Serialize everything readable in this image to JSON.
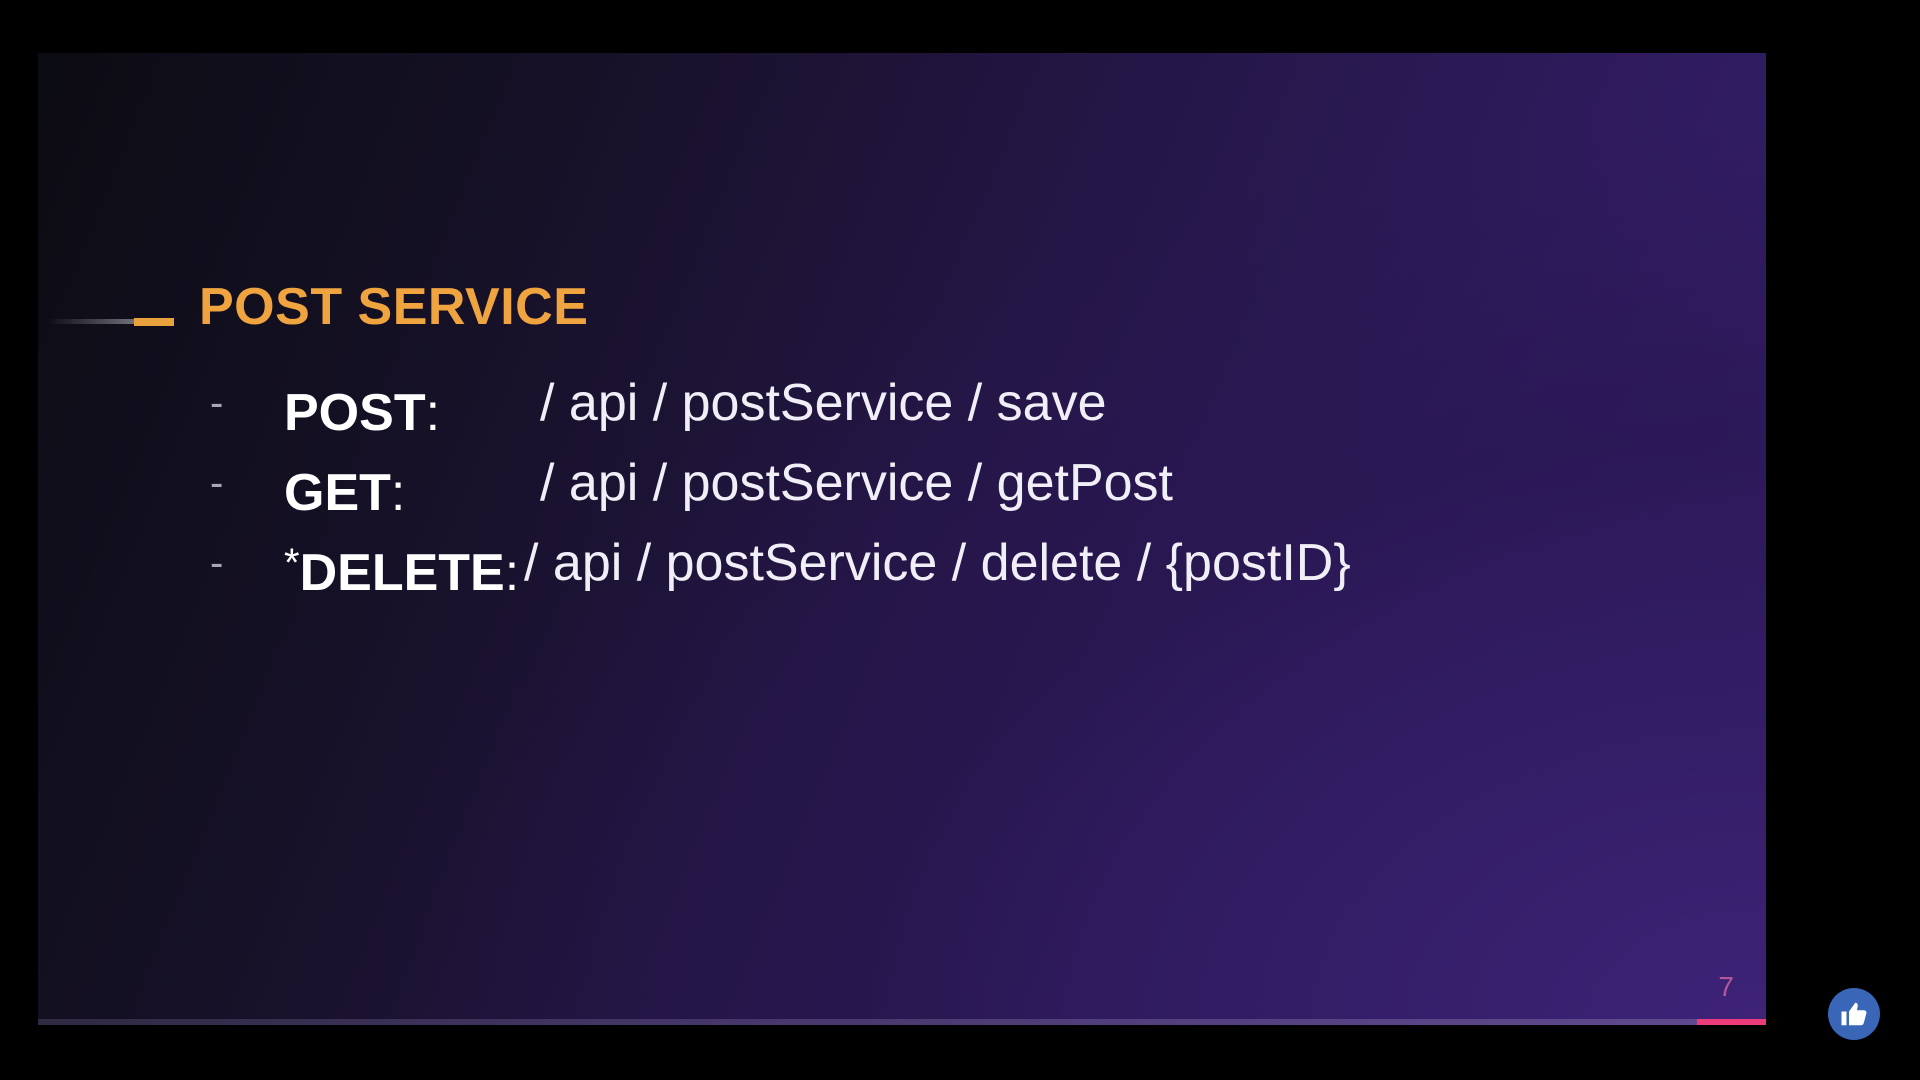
{
  "slide": {
    "title": "POST SERVICE",
    "endpoints": [
      {
        "bullet": "-",
        "prefix": "",
        "method": "POST",
        "colon": ":",
        "path": "/ api / postService / save"
      },
      {
        "bullet": "-",
        "prefix": "",
        "method": "GET",
        "colon": ":",
        "path": "/ api / postService / getPost"
      },
      {
        "bullet": "-",
        "prefix": "*",
        "method": "DELETE",
        "colon": ":",
        "path": "/ api / postService / delete / {postID}"
      }
    ],
    "page_number": "7",
    "progress_fraction": 0.04
  },
  "overlay": {
    "like_icon": "thumbs-up-icon"
  },
  "colors": {
    "title": "#f0a440",
    "accent_dash": "#e8a13c",
    "progress": "#ee3b7a",
    "page_number": "#b0589a",
    "like_button": "#3a66b8"
  }
}
